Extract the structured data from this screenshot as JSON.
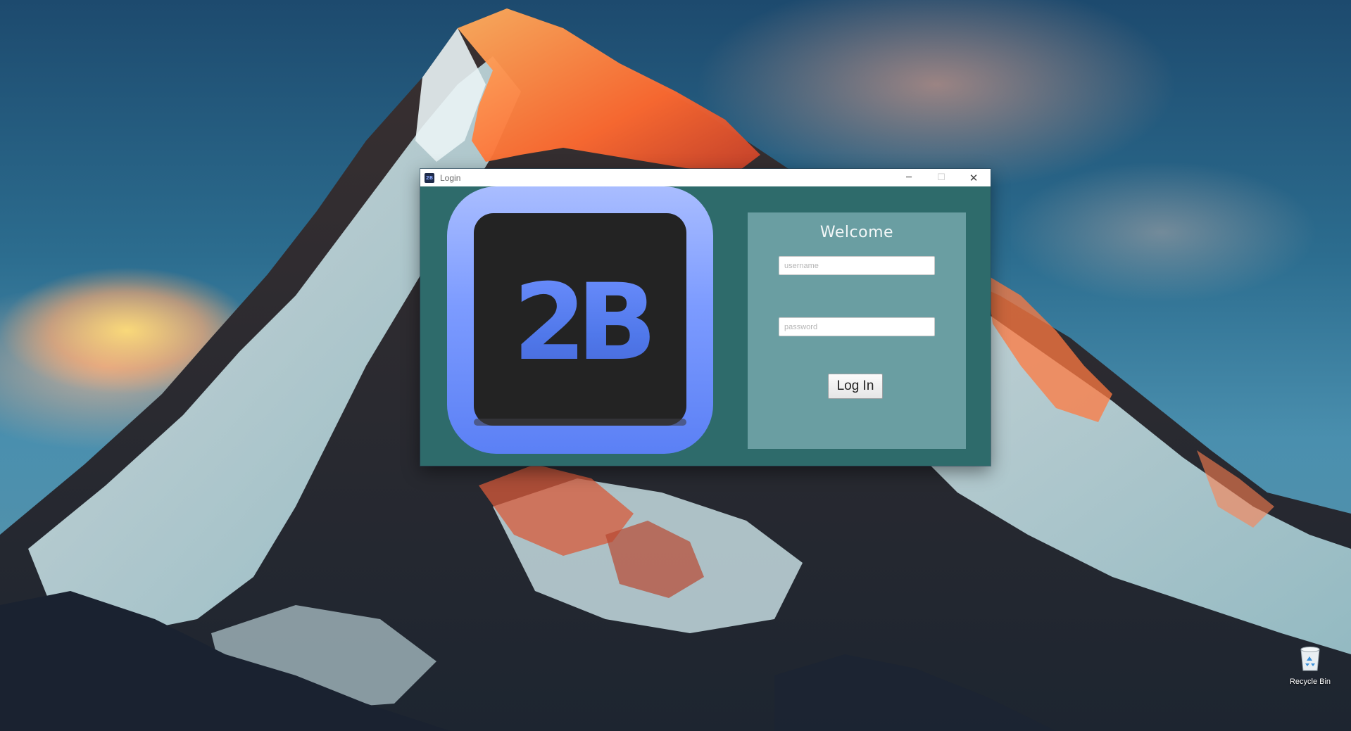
{
  "desktop": {
    "wallpaper": "snow-capped-mountain-sunset",
    "icons": [
      {
        "label": "Recycle Bin",
        "icon": "recycle-bin-icon"
      }
    ]
  },
  "window": {
    "title": "Login",
    "title_icon": "2B",
    "controls": {
      "minimize": "─",
      "maximize": "☐",
      "close": "✕"
    }
  },
  "logo": {
    "text": "2B",
    "colors": {
      "frame": "#6f95ff",
      "inner": "#222222",
      "text": "#5a80f0"
    }
  },
  "form": {
    "heading": "Welcome",
    "username": {
      "placeholder": "username",
      "value": ""
    },
    "password": {
      "placeholder": "password",
      "value": ""
    },
    "submit_label": "Log In"
  },
  "colors": {
    "window_bg": "#2e6b6b",
    "panel_bg": "#6a9ea2",
    "titlebar_bg": "#ffffff"
  }
}
